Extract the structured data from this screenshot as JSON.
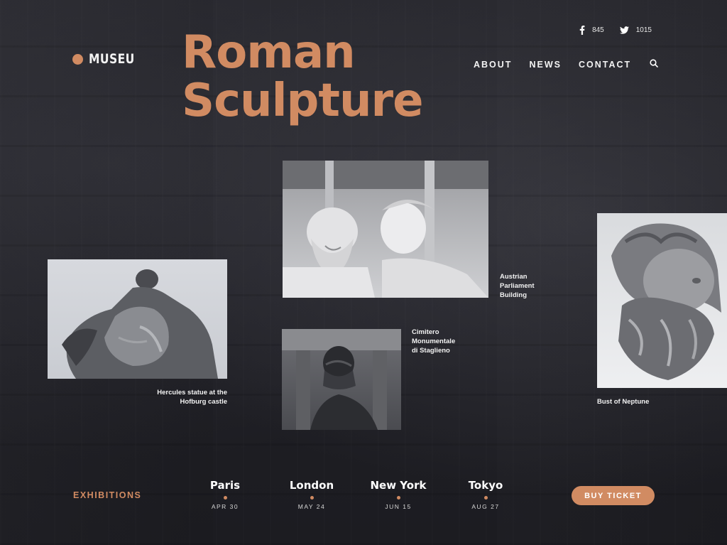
{
  "brand": {
    "name": "MUSEU"
  },
  "hero": {
    "title_line1": "Roman",
    "title_line2": "Sculpture"
  },
  "social": {
    "facebook_count": "845",
    "twitter_count": "1015"
  },
  "nav": {
    "items": [
      "ABOUT",
      "NEWS",
      "CONTACT"
    ]
  },
  "gallery": {
    "hercules": "Hercules statue at the Hofburg castle",
    "hercules_l1": "Hercules statue at the",
    "hercules_l2": "Hofburg castle",
    "austrian_l1": "Austrian",
    "austrian_l2": "Parliament",
    "austrian_l3": "Building",
    "cimitero_l1": "Cimitero",
    "cimitero_l2": "Monumentale",
    "cimitero_l3": "di Staglieno",
    "neptune": "Bust of Neptune"
  },
  "exhibitions": {
    "label": "EXHIBITIONS",
    "cities": [
      {
        "name": "Paris",
        "date": "APR 30"
      },
      {
        "name": "London",
        "date": "MAY 24"
      },
      {
        "name": "New York",
        "date": "JUN 15"
      },
      {
        "name": "Tokyo",
        "date": "AUG 27"
      }
    ],
    "cta": "BUY TICKET"
  },
  "colors": {
    "accent": "#d18b62",
    "background": "#222228"
  }
}
